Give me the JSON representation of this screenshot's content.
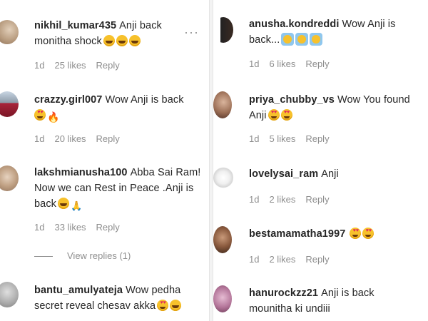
{
  "left": [
    {
      "username": "nikhil_kumar435",
      "line1": "Anji back",
      "line2": "monitha shock",
      "line3": "",
      "emojis": [
        "laugh",
        "laugh",
        "laugh"
      ],
      "time": "1d",
      "likes": "25 likes",
      "reply": "Reply",
      "more": "···"
    },
    {
      "username": "crazzy.girl007",
      "line1": "Wow Anji is back",
      "line2": "",
      "line3": "",
      "emojis": [
        "heart",
        "fire"
      ],
      "time": "1d",
      "likes": "20 likes",
      "reply": "Reply"
    },
    {
      "username": "lakshmianusha100",
      "line1": "Abba Sai Ram!",
      "line2": "Now we can Rest in Peace .Anji is",
      "line3": "back",
      "emojis": [
        "laugh",
        "pray"
      ],
      "time": "1d",
      "likes": "33 likes",
      "reply": "Reply",
      "view_replies": "View replies (1)"
    },
    {
      "username": "bantu_amulyateja",
      "line1": "Wow pedha",
      "line2": "secret reveal chesav akka",
      "line3": "",
      "emojis": [
        "heart",
        "laugh"
      ]
    }
  ],
  "right": [
    {
      "username": "anusha.kondreddi",
      "line1": "Wow Anji is",
      "line2": "back...",
      "emojis": [
        "sq",
        "sq",
        "sq"
      ],
      "time": "1d",
      "likes": "6 likes",
      "reply": "Reply"
    },
    {
      "username": "priya_chubby_vs",
      "line1": "Wow You found",
      "line2": "Anji",
      "emojis": [
        "heart",
        "heart"
      ],
      "time": "1d",
      "likes": "5 likes",
      "reply": "Reply"
    },
    {
      "username": "lovelysai_ram",
      "line1": "Anji",
      "line2": "",
      "emojis": [],
      "time": "1d",
      "likes": "2 likes",
      "reply": "Reply"
    },
    {
      "username": "bestamamatha1997",
      "line1": "",
      "line2": "",
      "emojis": [
        "heart",
        "heart"
      ],
      "time": "1d",
      "likes": "2 likes",
      "reply": "Reply"
    },
    {
      "username": "hanurockzz21",
      "line1": "Anji is back",
      "line2": "mounitha ki undiii",
      "emojis": []
    }
  ],
  "colors": {
    "text": "#262626",
    "muted": "#8e8e8e",
    "divider": "#f3f3f3"
  }
}
